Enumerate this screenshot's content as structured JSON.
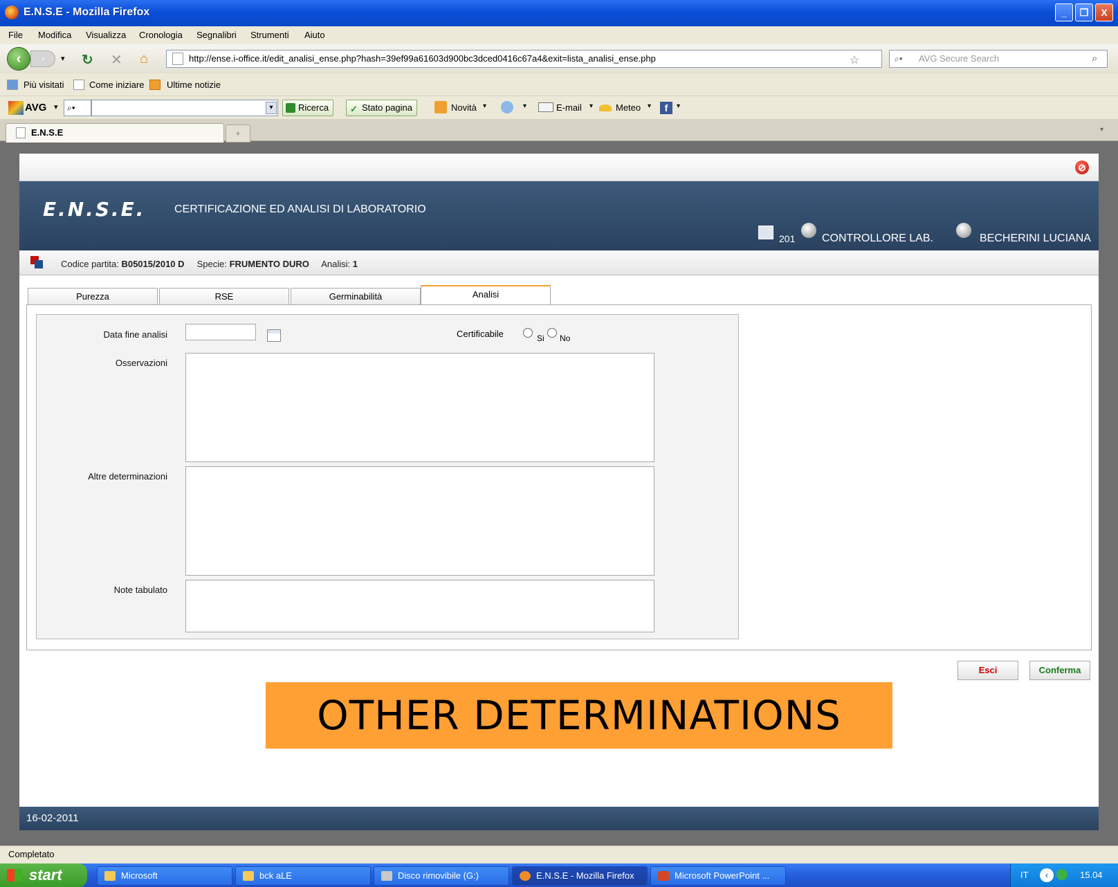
{
  "window": {
    "title": "E.N.S.E - Mozilla Firefox",
    "controls": [
      "_",
      "❐",
      "X"
    ]
  },
  "menu": [
    "File",
    "Modifica",
    "Visualizza",
    "Cronologia",
    "Segnalibri",
    "Strumenti",
    "Aiuto"
  ],
  "nav": {
    "url": "http://ense.i-office.it/edit_analisi_ense.php?hash=39ef99a61603d900bc3dced0416c67a4&exit=lista_analisi_ense.php",
    "search_placeholder": "AVG Secure Search"
  },
  "bookmarks": [
    "Più visitati",
    "Come iniziare",
    "Ultime notizie"
  ],
  "avg_toolbar": {
    "brand": "AVG",
    "ricerca": "Ricerca",
    "stato_pagina": "Stato pagina",
    "novita": "Novità",
    "email": "E-mail",
    "meteo": "Meteo"
  },
  "browser_tab": {
    "label": "E.N.S.E",
    "new_tab": "+"
  },
  "app": {
    "logo": "E.N.S.E.",
    "title": "CERTIFICAZIONE ED ANALISI DI LABORATORIO",
    "user_year": "201",
    "role": "CONTROLLORE LAB.",
    "user_name": "BECHERINI LUCIANA",
    "info": {
      "codice_label": "Codice partita:",
      "codice_value": "B05015/2010 D",
      "specie_label": "Specie:",
      "specie_value": "FRUMENTO DURO",
      "analisi_label": "Analisi:",
      "analisi_value": "1"
    },
    "tabs": [
      "Purezza",
      "RSE",
      "Germinabilità",
      "Analisi"
    ],
    "form": {
      "data_fine_label": "Data fine analisi",
      "data_fine_value": "",
      "certificabile_label": "Certificabile",
      "option_si": "Si",
      "option_no": "No",
      "osservazioni_label": "Osservazioni",
      "altre_label": "Altre determinazioni",
      "note_label": "Note tabulato"
    },
    "buttons": {
      "esci": "Esci",
      "conferma": "Conferma"
    },
    "footer_date": "16-02-2011"
  },
  "banner_text": "OTHER DETERMINATIONS",
  "status_text": "Completato",
  "taskbar": {
    "start": "start",
    "items": [
      "Microsoft",
      "bck aLE",
      "Disco rimovibile (G:)",
      "E.N.S.E - Mozilla Firefox",
      "Microsoft PowerPoint ..."
    ],
    "lang": "IT",
    "clock": "15.04"
  },
  "colors": {
    "header_blue": "#2f4b6c",
    "tab_accent": "#f0a030",
    "banner_orange": "#ffa035",
    "esci_red": "#cc0000",
    "conferma_green": "#1a7a1a"
  }
}
